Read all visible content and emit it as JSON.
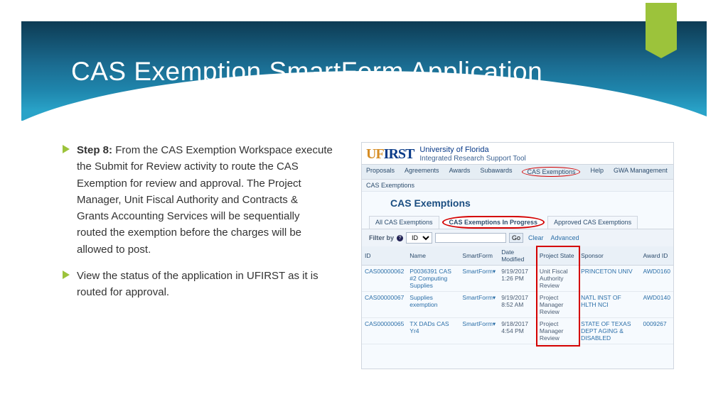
{
  "banner": {
    "title": "CAS Exemption SmartForm Application"
  },
  "bullets": [
    {
      "label": "Step 8:",
      "text": "From the CAS Exemption Workspace execute the Submit for Review activity to route the CAS Exemption for review and approval. The Project Manager, Unit Fiscal Authority and Contracts & Grants Accounting Services will be sequentially routed the exemption before the charges will be allowed to post."
    },
    {
      "label": "",
      "text": "View the status of the application in UFIRST as it is routed for approval."
    }
  ],
  "shot": {
    "logo_main": "UF",
    "logo_rest": "IRST",
    "site_line1": "University of Florida",
    "site_line2": "Integrated Research Support Tool",
    "nav": [
      "Proposals",
      "Agreements",
      "Awards",
      "Subawards",
      "CAS Exemptions",
      "Help",
      "GWA Management"
    ],
    "nav_circled_index": 4,
    "crumb": "CAS Exemptions",
    "page_title": "CAS Exemptions",
    "subtabs": [
      "All CAS Exemptions",
      "CAS Exemptions In Progress",
      "Approved CAS Exemptions"
    ],
    "subtab_active_index": 1,
    "filter": {
      "label": "Filter by",
      "field": "ID",
      "go": "Go",
      "clear": "Clear",
      "advanced": "Advanced"
    },
    "columns": [
      "ID",
      "Name",
      "SmartForm",
      "Date Modified",
      "Project State",
      "Sponsor",
      "Award ID"
    ],
    "rows": [
      {
        "id": "CAS00000062",
        "name": "P0036391 CAS #2 Computing Supplies",
        "sf": "SmartForm▾",
        "date": "9/19/2017 1:26 PM",
        "state": "Unit Fiscal Authority Review",
        "sponsor": "PRINCETON UNIV",
        "award": "AWD0160"
      },
      {
        "id": "CAS00000067",
        "name": "Supplies exemption",
        "sf": "SmartForm▾",
        "date": "9/19/2017 8:52 AM",
        "state": "Project Manager Review",
        "sponsor": "NATL INST OF HLTH NCI",
        "award": "AWD0140"
      },
      {
        "id": "CAS00000065",
        "name": "TX DADs CAS Yr4",
        "sf": "SmartForm▾",
        "date": "9/18/2017 4:54 PM",
        "state": "Project Manager Review",
        "sponsor": "STATE OF TEXAS DEPT AGING & DISABLED",
        "award": "0009267"
      }
    ]
  }
}
